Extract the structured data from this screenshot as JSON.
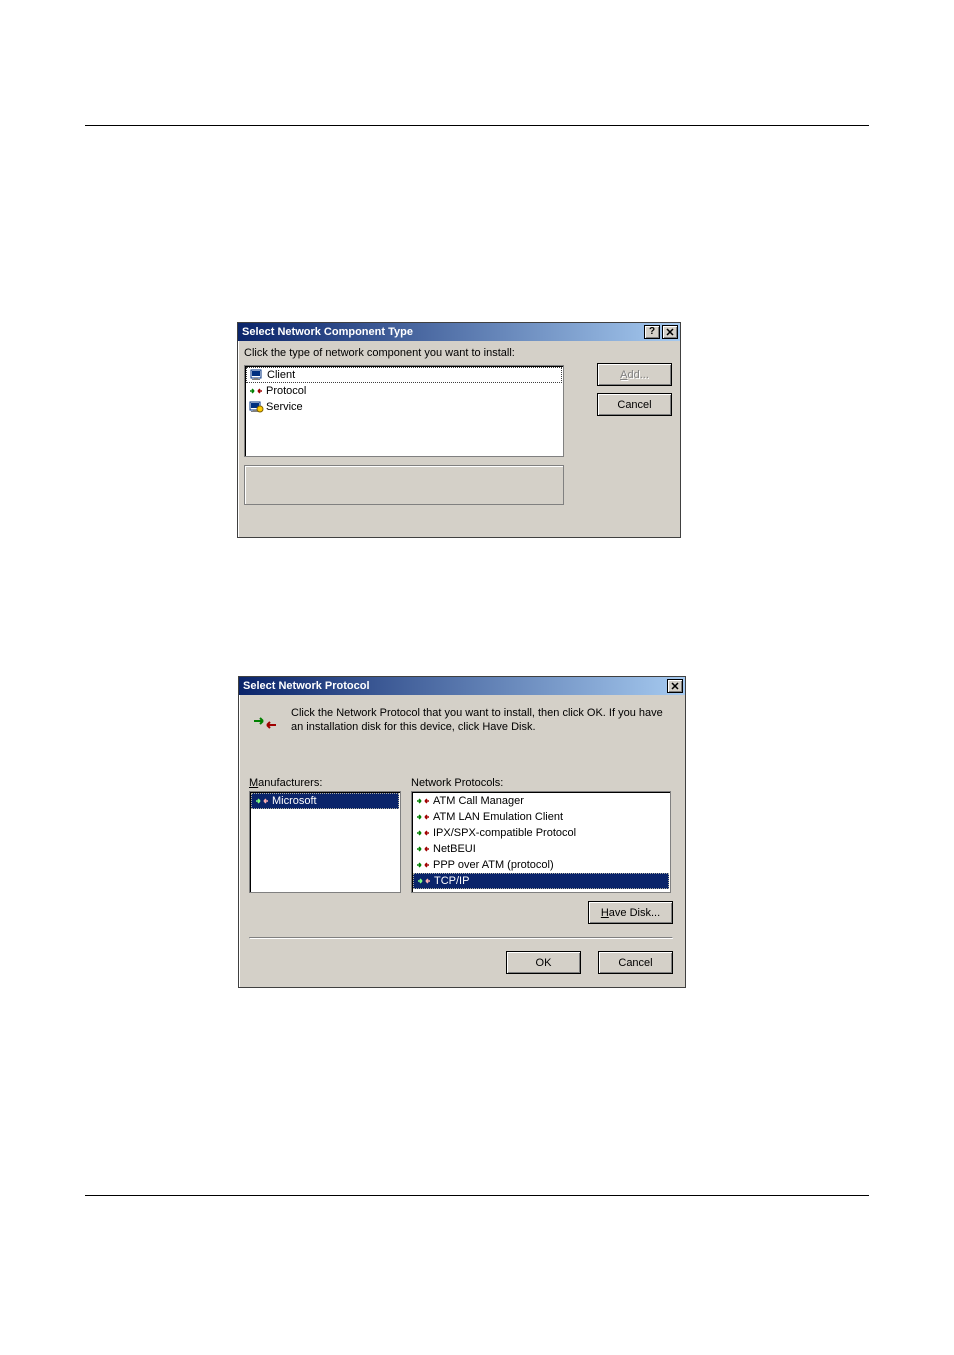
{
  "dialog1": {
    "title": "Select Network Component Type",
    "prompt": "Click the type of network component you want to install:",
    "items": [
      {
        "label": "Client",
        "icon": "client-icon",
        "selected": true
      },
      {
        "label": "Protocol",
        "icon": "protocol-icon",
        "selected": false
      },
      {
        "label": "Service",
        "icon": "service-icon",
        "selected": false
      }
    ],
    "add_label": "Add...",
    "cancel_label": "Cancel"
  },
  "dialog2": {
    "title": "Select Network Protocol",
    "instructions": "Click the Network Protocol that you want to install, then click OK. If you have an installation disk for this device, click Have Disk.",
    "manufacturers_label": "Manufacturers:",
    "protocols_label": "Network Protocols:",
    "manufacturers": [
      {
        "label": "Microsoft",
        "selected": true
      }
    ],
    "protocols": [
      {
        "label": "ATM Call Manager",
        "selected": false
      },
      {
        "label": "ATM LAN Emulation Client",
        "selected": false
      },
      {
        "label": "IPX/SPX-compatible Protocol",
        "selected": false
      },
      {
        "label": "NetBEUI",
        "selected": false
      },
      {
        "label": "PPP over ATM (protocol)",
        "selected": false
      },
      {
        "label": "TCP/IP",
        "selected": true
      }
    ],
    "have_disk_label": "Have Disk...",
    "ok_label": "OK",
    "cancel_label": "Cancel"
  }
}
